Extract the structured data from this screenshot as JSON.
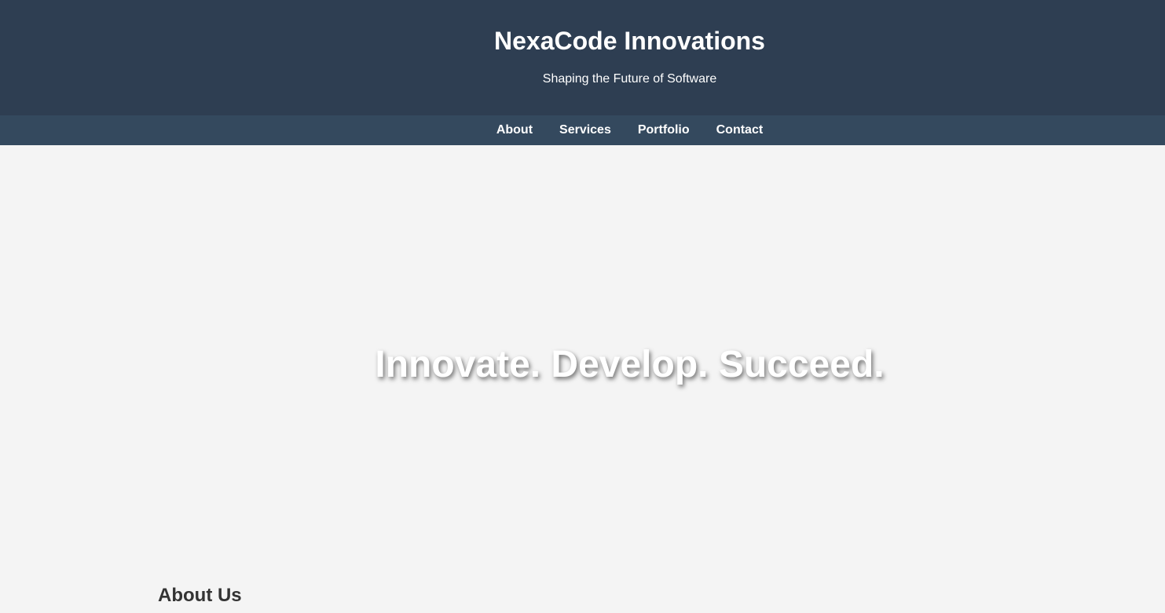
{
  "header": {
    "title": "NexaCode Innovations",
    "tagline": "Shaping the Future of Software"
  },
  "nav": {
    "items": [
      {
        "label": "About"
      },
      {
        "label": "Services"
      },
      {
        "label": "Portfolio"
      },
      {
        "label": "Contact"
      }
    ]
  },
  "hero": {
    "headline": "Innovate. Develop. Succeed."
  },
  "about": {
    "heading": "About Us"
  },
  "colors": {
    "header_bg": "#2e3e52",
    "nav_bg": "#34495e",
    "page_bg": "#f4f4f4",
    "text_light": "#ffffff",
    "text_dark": "#333333"
  }
}
